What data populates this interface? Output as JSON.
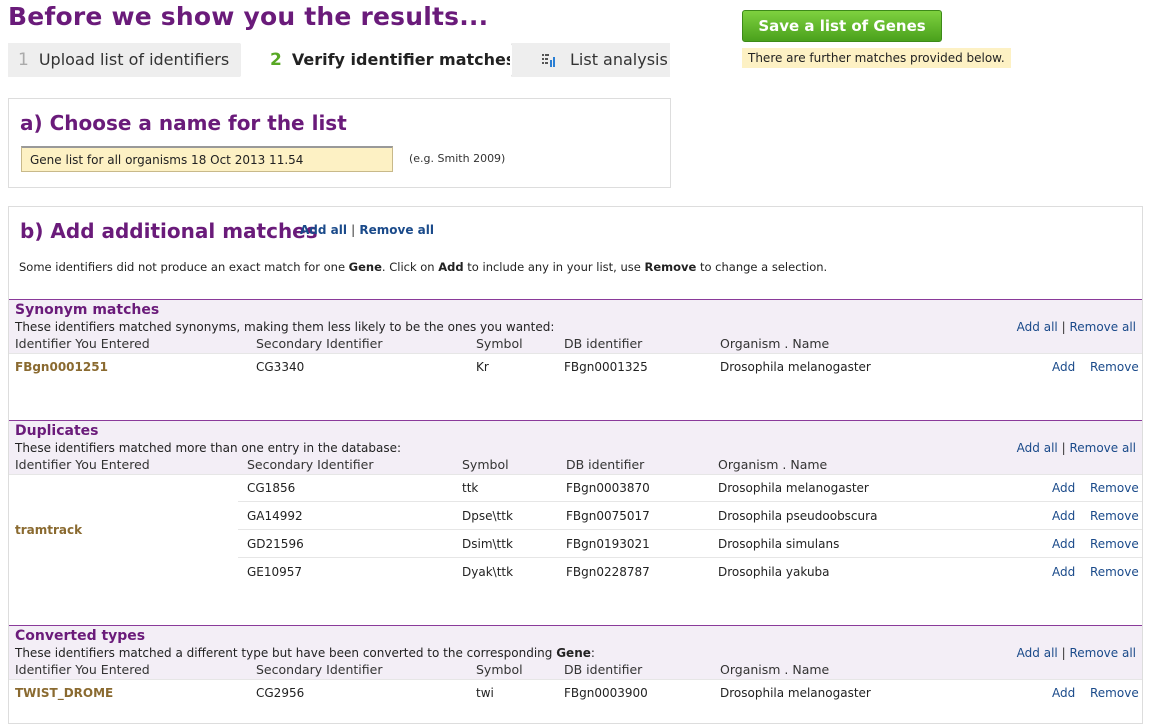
{
  "page_title": "Before we show you the results...",
  "steps": [
    {
      "num": "1",
      "label": "Upload list of identifiers"
    },
    {
      "num": "2",
      "label": "Verify identifier matches"
    },
    {
      "label": "List analysis",
      "icon": "bar-chart-icon"
    }
  ],
  "save_button": "Save a list of Genes",
  "notice": "There are further matches provided below.",
  "section_a": {
    "title": "a) Choose a name for the list",
    "list_name_value": "Gene list for all organisms 18 Oct 2013 11.54",
    "hint": "(e.g. Smith 2009)"
  },
  "section_b": {
    "title": "b) Add additional matches",
    "add_all": "Add all",
    "separator": "|",
    "remove_all": "Remove all",
    "description_parts": [
      "Some identifiers did not produce an exact match for one ",
      "Gene",
      ". Click on ",
      "Add",
      " to include any in your list, use ",
      "Remove",
      " to change a selection."
    ]
  },
  "columns": [
    "Identifier You Entered",
    "Secondary Identifier",
    "Symbol",
    "DB identifier",
    "Organism . Name"
  ],
  "actions": {
    "add": "Add",
    "remove": "Remove",
    "add_all": "Add all",
    "remove_all": "Remove all",
    "sep": "|"
  },
  "synonyms": {
    "title": "Synonym matches",
    "description": "These identifiers matched synonyms, making them less likely to be the ones you wanted:",
    "entered": "FBgn0001251",
    "rows": [
      {
        "secondary": "CG3340",
        "symbol": "Kr",
        "db": "FBgn0001325",
        "organism": "Drosophila melanogaster"
      }
    ]
  },
  "duplicates": {
    "title": "Duplicates",
    "description": "These identifiers matched more than one entry in the database:",
    "entered": "tramtrack",
    "rows": [
      {
        "secondary": "CG1856",
        "symbol": "ttk",
        "db": "FBgn0003870",
        "organism": "Drosophila melanogaster"
      },
      {
        "secondary": "GA14992",
        "symbol": "Dpse\\ttk",
        "db": "FBgn0075017",
        "organism": "Drosophila pseudoobscura"
      },
      {
        "secondary": "GD21596",
        "symbol": "Dsim\\ttk",
        "db": "FBgn0193021",
        "organism": "Drosophila simulans"
      },
      {
        "secondary": "GE10957",
        "symbol": "Dyak\\ttk",
        "db": "FBgn0228787",
        "organism": "Drosophila yakuba"
      }
    ]
  },
  "converted": {
    "title": "Converted types",
    "description_parts": [
      "These identifiers matched a different type but have been converted to the corresponding ",
      "Gene",
      ":"
    ],
    "entered": "TWIST_DROME",
    "rows": [
      {
        "secondary": "CG2956",
        "symbol": "twi",
        "db": "FBgn0003900",
        "organism": "Drosophila melanogaster"
      }
    ]
  }
}
